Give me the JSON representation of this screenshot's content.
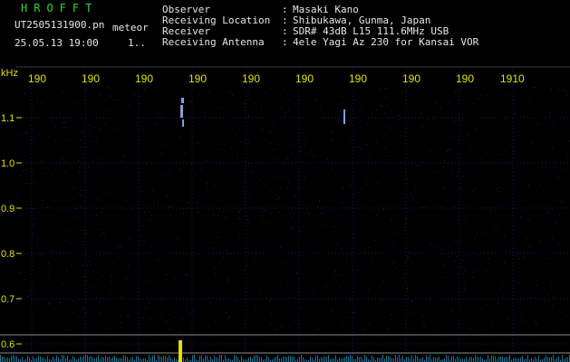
{
  "header": {
    "title": "HROFFT",
    "file_name": "UT2505131900.pn",
    "tag": "meteor",
    "timestamp": "25.05.13 19:00",
    "count": "1.."
  },
  "meta": [
    {
      "label": "Observer",
      "value": "Masaki Kano"
    },
    {
      "label": "Receiving Location",
      "value": "Shibukawa, Gunma, Japan"
    },
    {
      "label": "Receiver",
      "value": "SDR# 43dB L15 111.6MHz USB"
    },
    {
      "label": "Receiving Antenna",
      "value": "4ele Yagi Az 230 for Kansai VOR"
    }
  ],
  "colon": ":",
  "plot": {
    "y_unit": "kHz",
    "x_ticks": [
      "190",
      "190",
      "190",
      "190",
      "190",
      "190",
      "190",
      "190",
      "190",
      "1910"
    ],
    "y_ticks": [
      "1.1",
      "1.0",
      "0.9",
      "0.8",
      "0.7",
      "0.6"
    ],
    "colors": {
      "tick_text": "#e0e000",
      "grid": "#1a1a66",
      "background": "#000000",
      "echo": "#9fb8ff",
      "baseline_signal": "#e0e000",
      "noise": "#2aa6d6"
    }
  }
}
